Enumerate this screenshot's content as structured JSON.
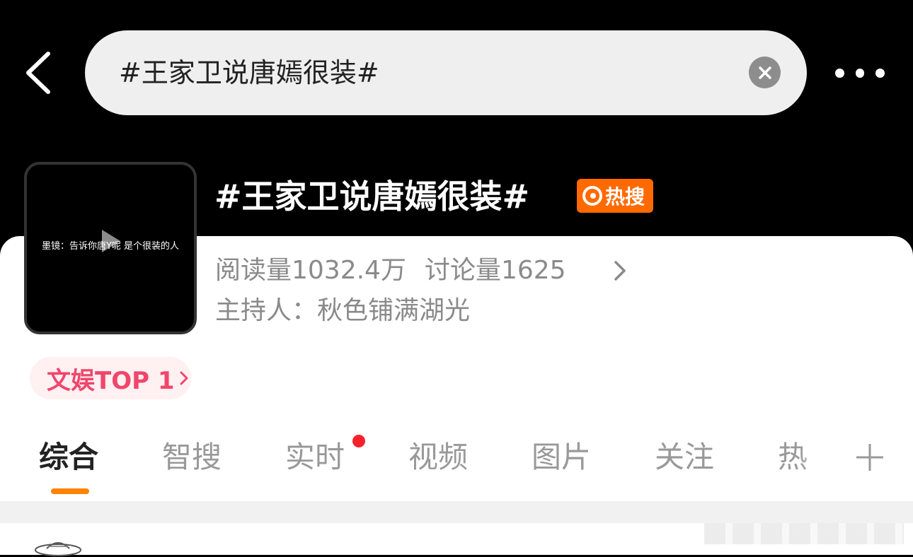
{
  "header": {
    "search_value": "#王家卫说唐嫣很装#",
    "back_icon": "chevron-left-icon",
    "clear_icon": "close-circle-icon",
    "more_icon": "more-horizontal-icon"
  },
  "topic": {
    "cover_caption": "墨镜：告诉你唐Y呢 是个很装的人",
    "title": "#王家卫说唐嫣很装#",
    "hot_badge": "热搜",
    "read_label": "阅读量1032.4万",
    "discuss_label": "讨论量1625",
    "host_label": "主持人：秋色铺满湖光",
    "rank_label": "文娱TOP 1"
  },
  "tabs": [
    {
      "label": "综合"
    },
    {
      "label": "智搜"
    },
    {
      "label": "实时"
    },
    {
      "label": "视频"
    },
    {
      "label": "图片"
    },
    {
      "label": "关注"
    },
    {
      "label": "热"
    }
  ],
  "colors": {
    "accent": "#ff8200",
    "hot_badge": "#ff6a00",
    "rank_text": "#f0466c",
    "red_dot": "#f5222d"
  }
}
